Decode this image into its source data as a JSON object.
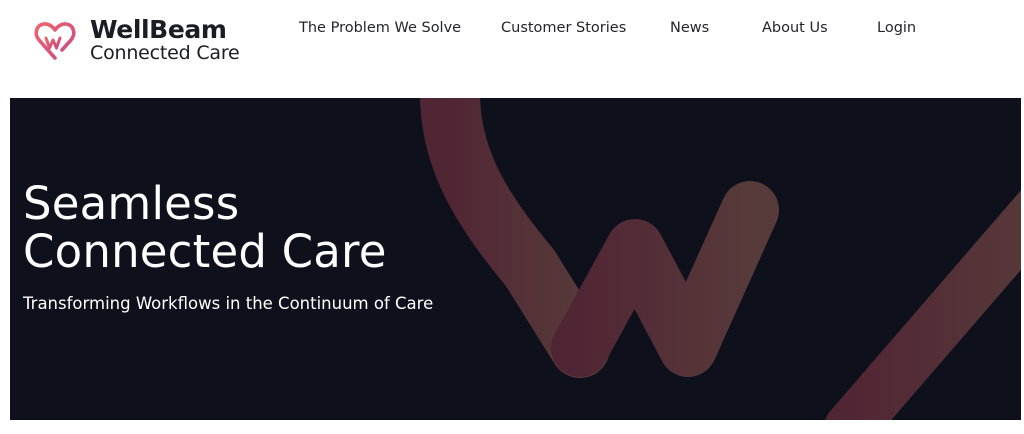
{
  "brand": {
    "name": "WellBeam",
    "tagline": "Connected Care",
    "colors": {
      "primary": "#e8505b",
      "secondary": "#c44a8f"
    }
  },
  "nav": {
    "items": [
      {
        "label": "The Problem We Solve"
      },
      {
        "label": "Customer Stories"
      },
      {
        "label": "News"
      },
      {
        "label": "About Us"
      },
      {
        "label": "Login"
      }
    ]
  },
  "hero": {
    "title_line1": "Seamless",
    "title_line2": "Connected Care",
    "subtitle": "Transforming Workflows in the Continuum of Care",
    "background_color": "#0e111b",
    "accent_color": "#5a2a34"
  }
}
